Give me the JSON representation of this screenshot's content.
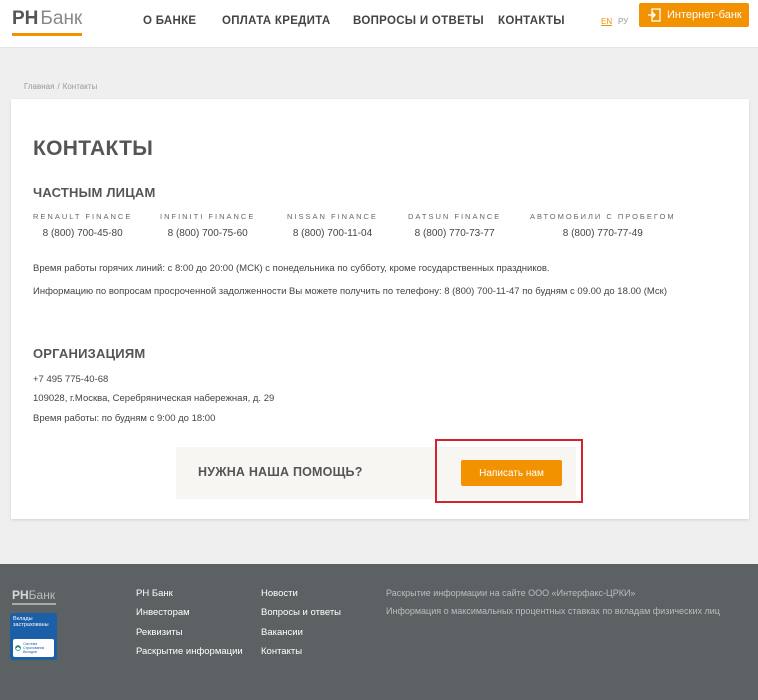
{
  "header": {
    "logo_rh": "РН",
    "logo_bank": "Банк",
    "nav": [
      "О БАНКЕ",
      "ОПЛАТА КРЕДИТА",
      "ВОПРОСЫ И ОТВЕТЫ",
      "КОНТАКТЫ"
    ],
    "lang_en": "EN",
    "lang_ru": "РУ",
    "internet_bank": "Интернет-банк"
  },
  "breadcrumb": {
    "home": "Главная",
    "sep": "/",
    "current": "Контакты"
  },
  "page_title": "КОНТАКТЫ",
  "individuals": {
    "heading": "ЧАСТНЫМ ЛИЦАМ",
    "brands": [
      {
        "name": "RENAULT FINANCE",
        "phone": "8 (800) 700-45-80"
      },
      {
        "name": "INFINITI FINANCE",
        "phone": "8 (800) 700-75-60"
      },
      {
        "name": "NISSAN FINANCE",
        "phone": "8 (800) 700-11-04"
      },
      {
        "name": "DATSUN FINANCE",
        "phone": "8 (800) 770-73-77"
      },
      {
        "name": "АВТОМОБИЛИ С ПРОБЕГОМ",
        "phone": "8 (800) 770-77-49"
      }
    ],
    "hours_text": "Время работы горячих линий: с 8:00 до 20:00 (МСК) с понедельника по субботу, кроме государственных праздников.",
    "overdue_text": "Информацию по вопросам просроченной задолженности Вы можете получить по телефону: 8 (800) 700-11-47 по будням с 09.00 до 18.00 (Мск)"
  },
  "organizations": {
    "heading": "ОРГАНИЗАЦИЯМ",
    "phone": "+7 495 775-40-68",
    "address": "109028, г.Москва, Серебряническая набережная, д. 29",
    "hours": "Время работы: по будням с 9:00 до 18:00"
  },
  "help": {
    "question": "НУЖНА НАША ПОМОЩЬ?",
    "button": "Написать нам"
  },
  "footer": {
    "logo_rh": "РН",
    "logo_bank": "Банк",
    "badge_title": "Вклады застрахованы",
    "badge_small": "Система Страхования Вкладов",
    "col1": [
      "РН Банк",
      "Инвесторам",
      "Реквизиты",
      "Раскрытие информации"
    ],
    "col2": [
      "Новости",
      "Вопросы и ответы",
      "Вакансии",
      "Контакты"
    ],
    "info": [
      "Раскрытие информации на сайте ООО «Интерфакс-ЦРКИ»",
      "Информация о максимальных процентных ставках по вкладам физических лиц"
    ]
  },
  "colors": {
    "accent": "#f39200",
    "highlight": "#d3232c",
    "footer_bg": "#5c6263"
  }
}
